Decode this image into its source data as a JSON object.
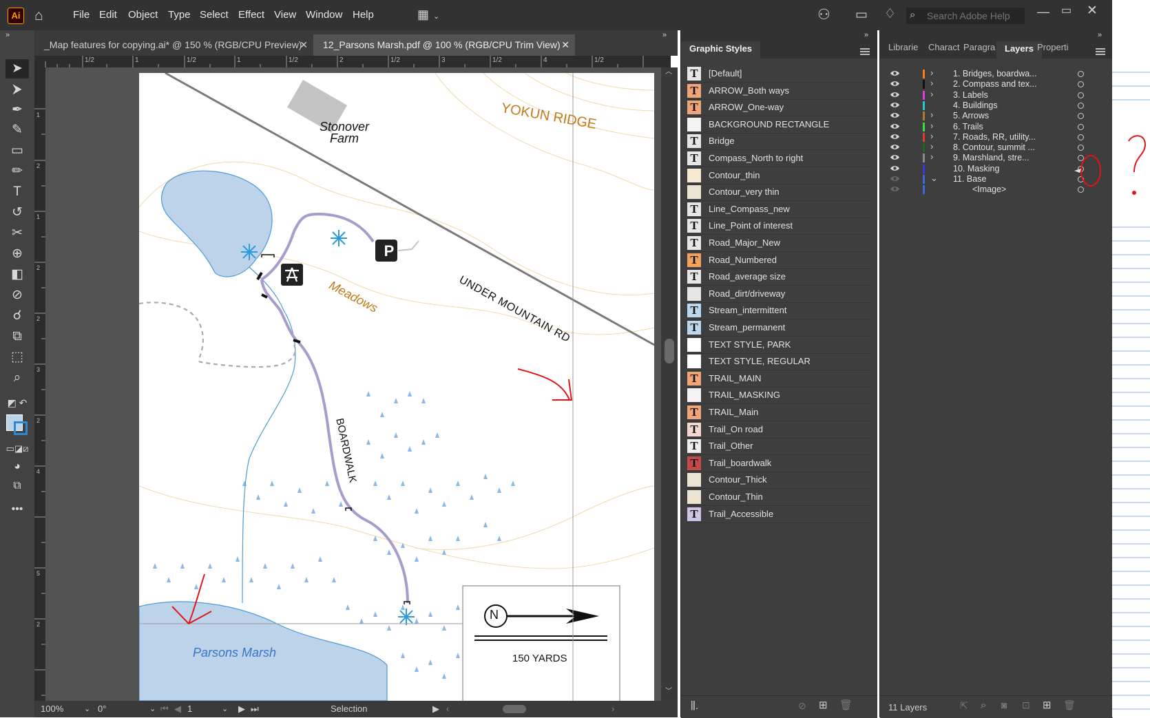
{
  "menubar": {
    "app_logo": "Ai",
    "items": [
      "File",
      "Edit",
      "Object",
      "Type",
      "Select",
      "Effect",
      "View",
      "Window",
      "Help"
    ],
    "search_placeholder": "Search Adobe Help",
    "icons": [
      "home-icon",
      "workspace-switcher-icon",
      "share-icon",
      "arrange-documents-icon",
      "lightbulb-icon",
      "search-icon",
      "minimize-icon",
      "maximize-icon",
      "close-icon"
    ]
  },
  "document_tabs": [
    {
      "title": "_Map features for copying.ai* @ 150 % (RGB/CPU Preview)",
      "active": false
    },
    {
      "title": "12_Parsons Marsh.pdf @ 100 % (RGB/CPU Trim View)",
      "active": true
    }
  ],
  "ruler": {
    "top_labels": [
      "1/2",
      "1",
      "1/2",
      "1",
      "1/2",
      "2",
      "1/2",
      "3",
      "1/2",
      "4",
      "1/2"
    ],
    "left_labels": [
      "1",
      "2",
      "1",
      "2",
      "2",
      "3",
      "2",
      "4",
      "5",
      "2"
    ]
  },
  "map": {
    "labels": {
      "farm": "Stonover",
      "farm2": "Farm",
      "ridge": "YOKUN RIDGE",
      "meadows": "Meadows",
      "road": "UNDER MOUNTAIN RD",
      "boardwalk": "BOARDWALK",
      "marsh": "Parsons Marsh",
      "scale": "150 YARDS",
      "north": "N",
      "parking": "P"
    },
    "colors": {
      "water": "#bdd3ea",
      "stream": "#4a9ad4",
      "trail": "#a99bcc",
      "contour": "#f1d9a8",
      "label_brown": "#c47a1a",
      "annotation_red": "#e0151b"
    }
  },
  "status": {
    "zoom": "100%",
    "rotation": "0°",
    "artboard": "1",
    "tool": "Selection"
  },
  "graphic_styles": {
    "title": "Graphic Styles",
    "items": [
      {
        "name": "[Default]",
        "thumb": "T",
        "tone": "#e6e6e6"
      },
      {
        "name": "ARROW_Both ways",
        "thumb": "T",
        "tone": "#f0a47a"
      },
      {
        "name": "ARROW_One-way",
        "thumb": "T",
        "tone": "#f0a47a"
      },
      {
        "name": "BACKGROUND RECTANGLE",
        "thumb": "",
        "tone": "#f3f3f3"
      },
      {
        "name": "Bridge",
        "thumb": "T",
        "tone": "#e6e6e6"
      },
      {
        "name": "Compass_North to right",
        "thumb": "T",
        "tone": "#e6e6e6"
      },
      {
        "name": "Contour_thin",
        "thumb": "",
        "tone": "#f6e9cf"
      },
      {
        "name": "Contour_very thin",
        "thumb": "",
        "tone": "#ebe2d2"
      },
      {
        "name": "Line_Compass_new",
        "thumb": "T",
        "tone": "#e6e6e6"
      },
      {
        "name": "Line_Point of interest",
        "thumb": "T",
        "tone": "#e6e6e6"
      },
      {
        "name": "Road_Major_New",
        "thumb": "T",
        "tone": "#e6e6e6"
      },
      {
        "name": "Road_Numbered",
        "thumb": "T",
        "tone": "#f0a260"
      },
      {
        "name": "Road_average size",
        "thumb": "T",
        "tone": "#e6e6e6"
      },
      {
        "name": "Road_dirt/driveway",
        "thumb": "",
        "tone": "#e6e6e6"
      },
      {
        "name": "Stream_intermittent",
        "thumb": "T",
        "tone": "#bcd8ef"
      },
      {
        "name": "Stream_permanent",
        "thumb": "T",
        "tone": "#bcd8ef"
      },
      {
        "name": "TEXT STYLE, PARK",
        "thumb": "",
        "tone": "#ffffff"
      },
      {
        "name": "TEXT STYLE, REGULAR",
        "thumb": "",
        "tone": "#ffffff"
      },
      {
        "name": "TRAIL_MAIN",
        "thumb": "T",
        "tone": "#f0a47a"
      },
      {
        "name": "TRAIL_MASKING",
        "thumb": "",
        "tone": "#f3f3f3"
      },
      {
        "name": "TRAIL_Main",
        "thumb": "T",
        "tone": "#f0a47a"
      },
      {
        "name": "Trail_On road",
        "thumb": "T",
        "tone": "#f3d8d0"
      },
      {
        "name": "Trail_Other",
        "thumb": "T",
        "tone": "#eeeeee"
      },
      {
        "name": "Trail_boardwalk",
        "thumb": "T",
        "tone": "#c44a4a"
      },
      {
        "name": "Contour_Thick",
        "thumb": "",
        "tone": "#ebe2d2"
      },
      {
        "name": "Contour_Thin",
        "thumb": "",
        "tone": "#ebe2d2"
      },
      {
        "name": "Trail_Accessible",
        "thumb": "T",
        "tone": "#cfc3e6"
      }
    ]
  },
  "layers_panel": {
    "tabs": [
      "Librarie",
      "Charact",
      "Paragra",
      "Layers",
      "Properti"
    ],
    "active_tab": "Layers",
    "layers": [
      {
        "name": "1. Bridges, boardwa...",
        "color": "#ff7a1a",
        "expandable": true,
        "visible": true
      },
      {
        "name": "2. Compass and tex...",
        "color": "#111111",
        "expandable": true,
        "visible": true
      },
      {
        "name": "3. Labels",
        "color": "#e23ce0",
        "expandable": true,
        "visible": true
      },
      {
        "name": "4. Buildings",
        "color": "#22c7d6",
        "expandable": false,
        "visible": true
      },
      {
        "name": "5. Arrows",
        "color": "#b07a2a",
        "expandable": true,
        "visible": true
      },
      {
        "name": "6. Trails",
        "color": "#36e03a",
        "expandable": true,
        "visible": true
      },
      {
        "name": "7. Roads, RR, utility...",
        "color": "#e83a2a",
        "expandable": true,
        "visible": true
      },
      {
        "name": "8. Contour, summit ...",
        "color": "#1a6a1a",
        "expandable": true,
        "visible": true
      },
      {
        "name": "9. Marshland, stre...",
        "color": "#8a8a8a",
        "expandable": true,
        "visible": true
      },
      {
        "name": "10. Masking",
        "color": "#3a3adf",
        "expandable": false,
        "visible": true
      },
      {
        "name": "11. Base",
        "color": "#3a6adf",
        "expandable": true,
        "expanded": true,
        "visible": false
      },
      {
        "name": "<Image>",
        "color": "#3a6adf",
        "expandable": false,
        "visible": false,
        "child": true
      }
    ],
    "count": "11 Layers"
  }
}
